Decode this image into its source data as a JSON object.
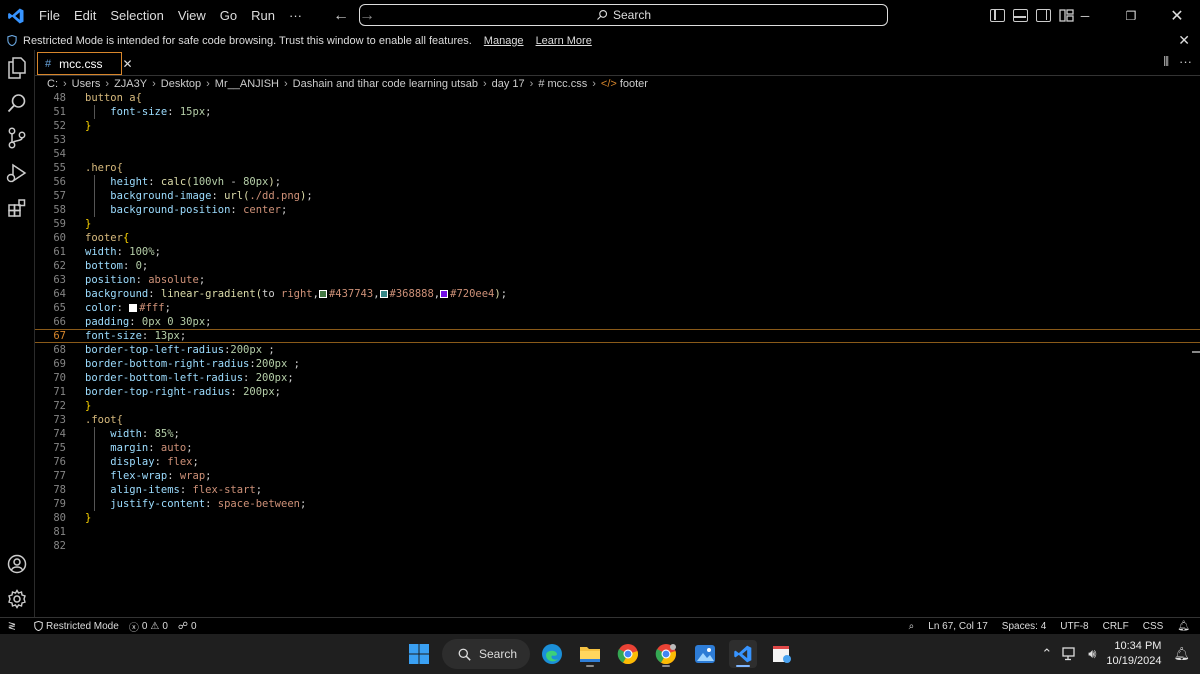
{
  "titlebar": {
    "menu": [
      "File",
      "Edit",
      "Selection",
      "View",
      "Go",
      "Run",
      "···"
    ],
    "search_label": "Search"
  },
  "banner": {
    "message": "Restricted Mode is intended for safe code browsing. Trust this window to enable all features.",
    "manage": "Manage",
    "learn_more": "Learn More"
  },
  "tab": {
    "hash": "#",
    "label": "mcc.css",
    "actions": [
      "⫴",
      "···"
    ]
  },
  "breadcrumb": [
    "C:",
    "Users",
    "ZJA3Y",
    "Desktop",
    "Mr__ANJISH",
    "Dashain and tihar code learning utsab",
    "day 17",
    "# mcc.css",
    "footer"
  ],
  "editor": {
    "lines": [
      {
        "n": "48",
        "tokens": [
          [
            "t-sel",
            "button a{"
          ]
        ]
      },
      {
        "n": "51",
        "tokens": [
          [
            "",
            "    "
          ],
          [
            "t-prop",
            "font-size"
          ],
          [
            "",
            ": "
          ],
          [
            "t-num",
            "15px"
          ],
          [
            "",
            ";"
          ]
        ]
      },
      {
        "n": "52",
        "tokens": [
          [
            "t-brace",
            "}"
          ]
        ]
      },
      {
        "n": "53",
        "tokens": []
      },
      {
        "n": "54",
        "tokens": []
      },
      {
        "n": "55",
        "tokens": [
          [
            "t-sel",
            ".hero{"
          ]
        ]
      },
      {
        "n": "56",
        "tokens": [
          [
            "",
            "    "
          ],
          [
            "t-prop",
            "height"
          ],
          [
            "",
            ": "
          ],
          [
            "t-fn",
            "calc("
          ],
          [
            "t-num",
            "100vh"
          ],
          [
            "",
            " - "
          ],
          [
            "t-num",
            "80px"
          ],
          [
            "t-fn",
            ")"
          ],
          [
            "",
            ";"
          ]
        ]
      },
      {
        "n": "57",
        "tokens": [
          [
            "",
            "    "
          ],
          [
            "t-prop",
            "background-image"
          ],
          [
            "",
            ": "
          ],
          [
            "t-fn",
            "url("
          ],
          [
            "t-kw",
            "./dd.png"
          ],
          [
            "t-fn",
            ")"
          ],
          [
            "",
            ";"
          ]
        ]
      },
      {
        "n": "58",
        "tokens": [
          [
            "",
            "    "
          ],
          [
            "t-prop",
            "background-position"
          ],
          [
            "",
            ": "
          ],
          [
            "t-kw",
            "center"
          ],
          [
            "",
            ";"
          ]
        ]
      },
      {
        "n": "59",
        "tokens": [
          [
            "t-brace",
            "}"
          ]
        ]
      },
      {
        "n": "60",
        "tokens": [
          [
            "t-sel",
            "footer"
          ],
          [
            "t-brace",
            "{"
          ]
        ]
      },
      {
        "n": "61",
        "tokens": [
          [
            "t-prop",
            "width"
          ],
          [
            "",
            ": "
          ],
          [
            "t-num",
            "100%"
          ],
          [
            "",
            ";"
          ]
        ]
      },
      {
        "n": "62",
        "tokens": [
          [
            "t-prop",
            "bottom"
          ],
          [
            "",
            ": "
          ],
          [
            "t-num",
            "0"
          ],
          [
            "",
            ";"
          ]
        ]
      },
      {
        "n": "63",
        "tokens": [
          [
            "t-prop",
            "position"
          ],
          [
            "",
            ": "
          ],
          [
            "t-kw",
            "absolute"
          ],
          [
            "",
            ";"
          ]
        ]
      },
      {
        "n": "64",
        "tokens": [
          [
            "t-prop",
            "background"
          ],
          [
            "",
            ": "
          ],
          [
            "t-fn",
            "linear-gradient("
          ],
          [
            "",
            "to "
          ],
          [
            "t-kw",
            "right"
          ],
          [
            "",
            ","
          ],
          [
            "sw:#437743",
            ""
          ],
          [
            "t-kw",
            "#437743"
          ],
          [
            "",
            ","
          ],
          [
            "sw:#368888",
            ""
          ],
          [
            "t-kw",
            "#368888"
          ],
          [
            "",
            ","
          ],
          [
            "sw:#720ee4",
            ""
          ],
          [
            "t-kw",
            "#720ee4"
          ],
          [
            "t-fn",
            ")"
          ],
          [
            "",
            ";"
          ]
        ]
      },
      {
        "n": "65",
        "tokens": [
          [
            "t-prop",
            "color"
          ],
          [
            "",
            ": "
          ],
          [
            "sw:#ffffff",
            ""
          ],
          [
            "t-kw",
            "#fff"
          ],
          [
            "",
            ";"
          ]
        ]
      },
      {
        "n": "66",
        "tokens": [
          [
            "t-prop",
            "padding"
          ],
          [
            "",
            ": "
          ],
          [
            "t-num",
            "0px 0 30px"
          ],
          [
            "",
            ";"
          ]
        ]
      },
      {
        "n": "67",
        "tokens": [
          [
            "t-prop",
            "font-size"
          ],
          [
            "",
            ": "
          ],
          [
            "t-num",
            "13px"
          ],
          [
            "",
            ";"
          ]
        ],
        "current": true
      },
      {
        "n": "68",
        "tokens": [
          [
            "t-prop",
            "border-top-left-radius"
          ],
          [
            "",
            ":"
          ],
          [
            "t-num",
            "200px"
          ],
          [
            "",
            " ;"
          ]
        ]
      },
      {
        "n": "69",
        "tokens": [
          [
            "t-prop",
            "border-bottom-right-radius"
          ],
          [
            "",
            ":"
          ],
          [
            "t-num",
            "200px"
          ],
          [
            "",
            " ;"
          ]
        ]
      },
      {
        "n": "70",
        "tokens": [
          [
            "t-prop",
            "border-bottom-left-radius"
          ],
          [
            "",
            ": "
          ],
          [
            "t-num",
            "200px"
          ],
          [
            "",
            ";"
          ]
        ]
      },
      {
        "n": "71",
        "tokens": [
          [
            "t-prop",
            "border-top-right-radius"
          ],
          [
            "",
            ": "
          ],
          [
            "t-num",
            "200px"
          ],
          [
            "",
            ";"
          ]
        ]
      },
      {
        "n": "72",
        "tokens": [
          [
            "t-brace",
            "}"
          ]
        ]
      },
      {
        "n": "73",
        "tokens": [
          [
            "t-sel",
            ".foot{"
          ]
        ]
      },
      {
        "n": "74",
        "tokens": [
          [
            "",
            "    "
          ],
          [
            "t-prop",
            "width"
          ],
          [
            "",
            ": "
          ],
          [
            "t-num",
            "85%"
          ],
          [
            "",
            ";"
          ]
        ]
      },
      {
        "n": "75",
        "tokens": [
          [
            "",
            "    "
          ],
          [
            "t-prop",
            "margin"
          ],
          [
            "",
            ": "
          ],
          [
            "t-kw",
            "auto"
          ],
          [
            "",
            ";"
          ]
        ]
      },
      {
        "n": "76",
        "tokens": [
          [
            "",
            "    "
          ],
          [
            "t-prop",
            "display"
          ],
          [
            "",
            ": "
          ],
          [
            "t-kw",
            "flex"
          ],
          [
            "",
            ";"
          ]
        ]
      },
      {
        "n": "77",
        "tokens": [
          [
            "",
            "    "
          ],
          [
            "t-prop",
            "flex-wrap"
          ],
          [
            "",
            ": "
          ],
          [
            "t-kw",
            "wrap"
          ],
          [
            "",
            ";"
          ]
        ]
      },
      {
        "n": "78",
        "tokens": [
          [
            "",
            "    "
          ],
          [
            "t-prop",
            "align-items"
          ],
          [
            "",
            ": "
          ],
          [
            "t-kw",
            "flex-start"
          ],
          [
            "",
            ";"
          ]
        ]
      },
      {
        "n": "79",
        "tokens": [
          [
            "",
            "    "
          ],
          [
            "t-prop",
            "justify-content"
          ],
          [
            "",
            ": "
          ],
          [
            "t-kw",
            "space-between"
          ],
          [
            "",
            ";"
          ]
        ]
      },
      {
        "n": "80",
        "tokens": [
          [
            "t-brace",
            "}"
          ]
        ]
      },
      {
        "n": "81",
        "tokens": []
      },
      {
        "n": "82",
        "tokens": []
      }
    ]
  },
  "statusbar": {
    "restricted": "Restricted Mode",
    "errors": "0",
    "warnings": "0",
    "ports": "0",
    "position": "Ln 67, Col 17",
    "spaces": "Spaces: 4",
    "encoding": "UTF-8",
    "eol": "CRLF",
    "language": "CSS"
  },
  "taskbar": {
    "search_label": "Search",
    "time": "10:34 PM",
    "date": "10/19/2024"
  },
  "colors": {
    "accent": "#d8862b",
    "vscode_blue": "#3794ff"
  }
}
